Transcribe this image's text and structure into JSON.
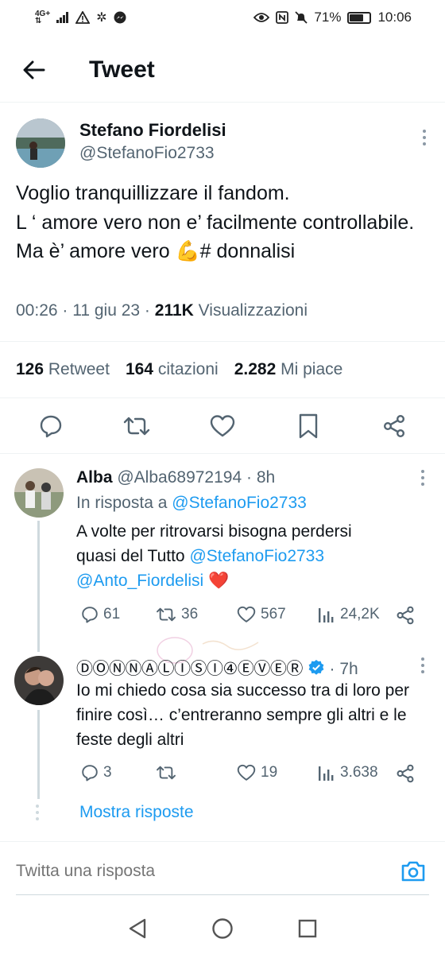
{
  "status_bar": {
    "network_top": "4G+",
    "network_bottom": "⇅",
    "battery": "71%",
    "battery_level": 0.71,
    "time": "10:06"
  },
  "header": {
    "title": "Tweet"
  },
  "tweet": {
    "author_name": "Stefano Fiordelisi",
    "author_handle": "@StefanoFio2733",
    "text": "Voglio tranquillizzare il fandom.\nL ‘ amore vero non e’ facilmente controllabile. Ma è’ amore vero 💪# donnalisi",
    "time": "00:26",
    "date": "11 giu 23",
    "views_count": "211K",
    "views_label": "Visualizzazioni",
    "retweets_count": "126",
    "retweets_label": "Retweet",
    "quotes_count": "164",
    "quotes_label": "citazioni",
    "likes_count": "2.282",
    "likes_label": "Mi piace"
  },
  "replies": [
    {
      "name": "Alba",
      "handle": "@Alba68972194",
      "time": "8h",
      "reply_to_label": "In risposta a",
      "reply_to_handle": "@StefanoFio2733",
      "text_line1": "A volte per ritrovarsi bisogna perdersi",
      "text_line2_prefix": "quasi del Tutto ",
      "mention1": "@StefanoFio2733",
      "mention2": "@Anto_Fiordelisi",
      "text_heart": "❤️",
      "replies": "61",
      "retweets": "36",
      "likes": "567",
      "views": "24,2K"
    },
    {
      "name": "ⒹⓄⓃⓃⒶⓁⒾⓈⒾ④ⒺⓋⒺⓇ",
      "time": "7h",
      "text": "Io mi chiedo cosa sia successo tra di loro per finire così… c’entreranno sempre gli altri e le feste degli altri",
      "replies": "3",
      "retweets": "",
      "likes": "19",
      "views": "3.638"
    }
  ],
  "show_replies": "Mostra risposte",
  "compose": {
    "placeholder": "Twitta una risposta"
  },
  "colors": {
    "accent": "#1d9bf0",
    "muted": "#536471",
    "text": "#0f1419",
    "heart": "#e0245e"
  }
}
